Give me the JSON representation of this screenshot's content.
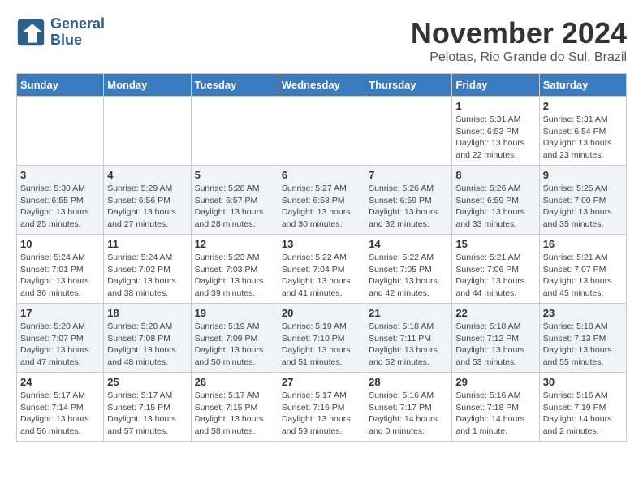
{
  "logo": {
    "line1": "General",
    "line2": "Blue"
  },
  "title": "November 2024",
  "location": "Pelotas, Rio Grande do Sul, Brazil",
  "weekdays": [
    "Sunday",
    "Monday",
    "Tuesday",
    "Wednesday",
    "Thursday",
    "Friday",
    "Saturday"
  ],
  "weeks": [
    [
      {
        "day": "",
        "info": ""
      },
      {
        "day": "",
        "info": ""
      },
      {
        "day": "",
        "info": ""
      },
      {
        "day": "",
        "info": ""
      },
      {
        "day": "",
        "info": ""
      },
      {
        "day": "1",
        "info": "Sunrise: 5:31 AM\nSunset: 6:53 PM\nDaylight: 13 hours\nand 22 minutes."
      },
      {
        "day": "2",
        "info": "Sunrise: 5:31 AM\nSunset: 6:54 PM\nDaylight: 13 hours\nand 23 minutes."
      }
    ],
    [
      {
        "day": "3",
        "info": "Sunrise: 5:30 AM\nSunset: 6:55 PM\nDaylight: 13 hours\nand 25 minutes."
      },
      {
        "day": "4",
        "info": "Sunrise: 5:29 AM\nSunset: 6:56 PM\nDaylight: 13 hours\nand 27 minutes."
      },
      {
        "day": "5",
        "info": "Sunrise: 5:28 AM\nSunset: 6:57 PM\nDaylight: 13 hours\nand 28 minutes."
      },
      {
        "day": "6",
        "info": "Sunrise: 5:27 AM\nSunset: 6:58 PM\nDaylight: 13 hours\nand 30 minutes."
      },
      {
        "day": "7",
        "info": "Sunrise: 5:26 AM\nSunset: 6:59 PM\nDaylight: 13 hours\nand 32 minutes."
      },
      {
        "day": "8",
        "info": "Sunrise: 5:26 AM\nSunset: 6:59 PM\nDaylight: 13 hours\nand 33 minutes."
      },
      {
        "day": "9",
        "info": "Sunrise: 5:25 AM\nSunset: 7:00 PM\nDaylight: 13 hours\nand 35 minutes."
      }
    ],
    [
      {
        "day": "10",
        "info": "Sunrise: 5:24 AM\nSunset: 7:01 PM\nDaylight: 13 hours\nand 36 minutes."
      },
      {
        "day": "11",
        "info": "Sunrise: 5:24 AM\nSunset: 7:02 PM\nDaylight: 13 hours\nand 38 minutes."
      },
      {
        "day": "12",
        "info": "Sunrise: 5:23 AM\nSunset: 7:03 PM\nDaylight: 13 hours\nand 39 minutes."
      },
      {
        "day": "13",
        "info": "Sunrise: 5:22 AM\nSunset: 7:04 PM\nDaylight: 13 hours\nand 41 minutes."
      },
      {
        "day": "14",
        "info": "Sunrise: 5:22 AM\nSunset: 7:05 PM\nDaylight: 13 hours\nand 42 minutes."
      },
      {
        "day": "15",
        "info": "Sunrise: 5:21 AM\nSunset: 7:06 PM\nDaylight: 13 hours\nand 44 minutes."
      },
      {
        "day": "16",
        "info": "Sunrise: 5:21 AM\nSunset: 7:07 PM\nDaylight: 13 hours\nand 45 minutes."
      }
    ],
    [
      {
        "day": "17",
        "info": "Sunrise: 5:20 AM\nSunset: 7:07 PM\nDaylight: 13 hours\nand 47 minutes."
      },
      {
        "day": "18",
        "info": "Sunrise: 5:20 AM\nSunset: 7:08 PM\nDaylight: 13 hours\nand 48 minutes."
      },
      {
        "day": "19",
        "info": "Sunrise: 5:19 AM\nSunset: 7:09 PM\nDaylight: 13 hours\nand 50 minutes."
      },
      {
        "day": "20",
        "info": "Sunrise: 5:19 AM\nSunset: 7:10 PM\nDaylight: 13 hours\nand 51 minutes."
      },
      {
        "day": "21",
        "info": "Sunrise: 5:18 AM\nSunset: 7:11 PM\nDaylight: 13 hours\nand 52 minutes."
      },
      {
        "day": "22",
        "info": "Sunrise: 5:18 AM\nSunset: 7:12 PM\nDaylight: 13 hours\nand 53 minutes."
      },
      {
        "day": "23",
        "info": "Sunrise: 5:18 AM\nSunset: 7:13 PM\nDaylight: 13 hours\nand 55 minutes."
      }
    ],
    [
      {
        "day": "24",
        "info": "Sunrise: 5:17 AM\nSunset: 7:14 PM\nDaylight: 13 hours\nand 56 minutes."
      },
      {
        "day": "25",
        "info": "Sunrise: 5:17 AM\nSunset: 7:15 PM\nDaylight: 13 hours\nand 57 minutes."
      },
      {
        "day": "26",
        "info": "Sunrise: 5:17 AM\nSunset: 7:15 PM\nDaylight: 13 hours\nand 58 minutes."
      },
      {
        "day": "27",
        "info": "Sunrise: 5:17 AM\nSunset: 7:16 PM\nDaylight: 13 hours\nand 59 minutes."
      },
      {
        "day": "28",
        "info": "Sunrise: 5:16 AM\nSunset: 7:17 PM\nDaylight: 14 hours\nand 0 minutes."
      },
      {
        "day": "29",
        "info": "Sunrise: 5:16 AM\nSunset: 7:18 PM\nDaylight: 14 hours\nand 1 minute."
      },
      {
        "day": "30",
        "info": "Sunrise: 5:16 AM\nSunset: 7:19 PM\nDaylight: 14 hours\nand 2 minutes."
      }
    ]
  ]
}
